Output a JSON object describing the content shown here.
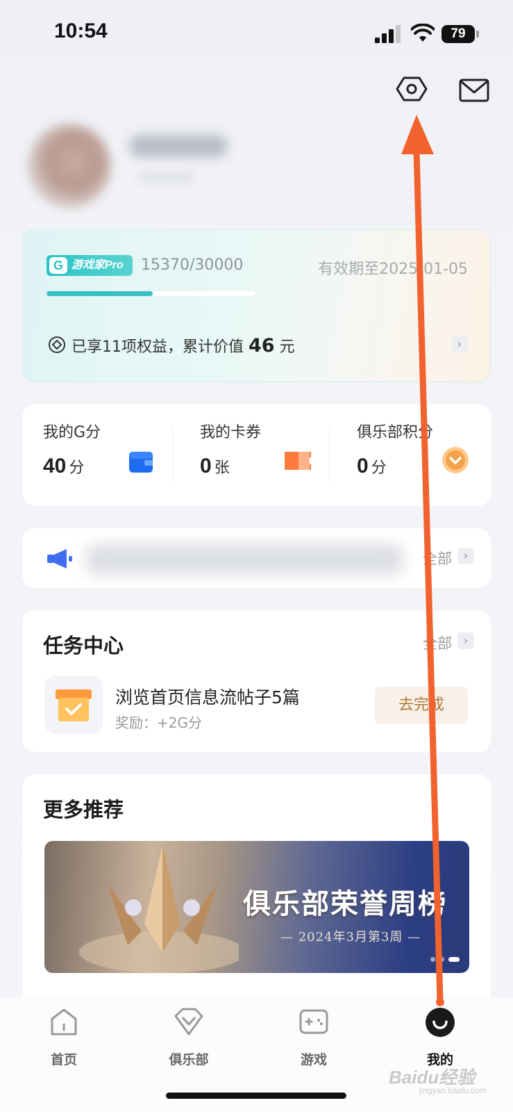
{
  "status_bar": {
    "time": "10:54",
    "battery": "79"
  },
  "header": {
    "settings_icon": "hexagon-settings-icon",
    "mail_icon": "mail-icon"
  },
  "pro_card": {
    "badge": "游戏家Pro",
    "score": "15370/30000",
    "progress": 0.51,
    "expire": "有效期至2025-01-05",
    "benefit_prefix": "已享11项权益，累计价值",
    "benefit_value": "46",
    "benefit_unit": "元"
  },
  "stats": [
    {
      "label": "我的G分",
      "value": "40",
      "unit": "分",
      "icon": "wallet-icon"
    },
    {
      "label": "我的卡券",
      "value": "0",
      "unit": "张",
      "icon": "ticket-icon"
    },
    {
      "label": "俱乐部积分",
      "value": "0",
      "unit": "分",
      "icon": "coin-icon"
    }
  ],
  "notice": {
    "all_label": "全部"
  },
  "tasks": {
    "title": "任务中心",
    "all_label": "全部",
    "item": {
      "title": "浏览首页信息流帖子5篇",
      "reward": "奖励：+2G分",
      "button": "去完成"
    }
  },
  "more": {
    "title": "更多推荐",
    "banner_title": "俱乐部荣誉周榜",
    "banner_sub": "— 2024年3月第3周 —"
  },
  "tabbar": [
    {
      "label": "首页",
      "icon": "home-icon"
    },
    {
      "label": "俱乐部",
      "icon": "diamond-icon"
    },
    {
      "label": "游戏",
      "icon": "gamepad-icon"
    },
    {
      "label": "我的",
      "icon": "smile-face-icon"
    }
  ],
  "watermark": {
    "brand": "Baidu经验",
    "url": "jingyan.baidu.com"
  },
  "colors": {
    "accent_teal": "#39bfc4",
    "arrow": "#f2622f",
    "task_button_text": "#b07a3a"
  }
}
